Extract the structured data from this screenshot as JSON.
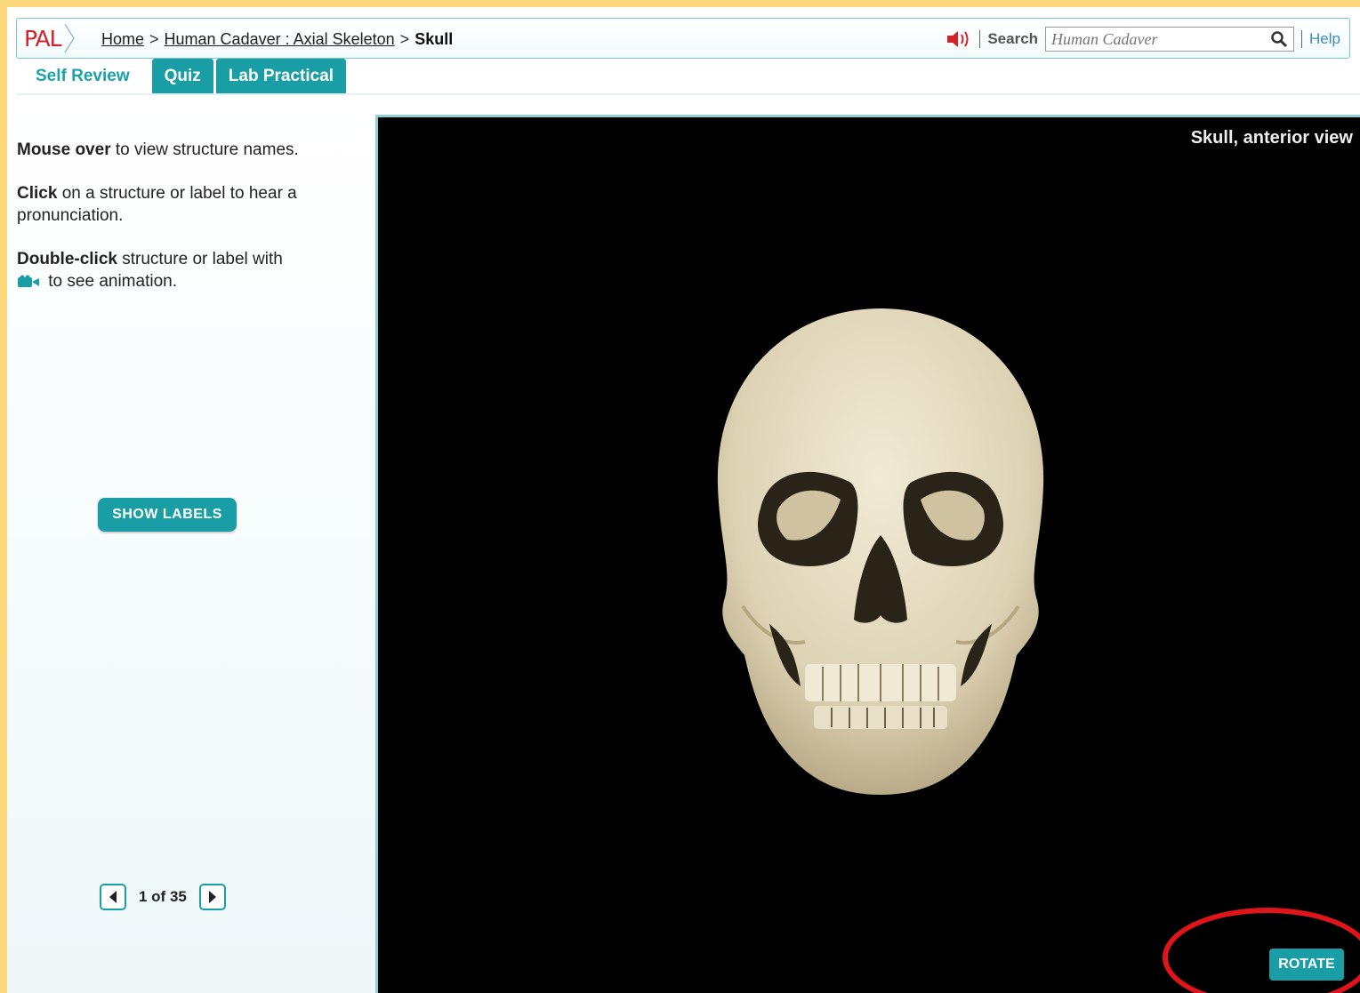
{
  "header": {
    "logo": "PAL",
    "breadcrumb": {
      "home": "Home",
      "section": "Human Cadaver : Axial Skeleton",
      "current": "Skull",
      "sep": ">"
    },
    "search_label": "Search",
    "search_placeholder": "Human Cadaver",
    "help": "Help"
  },
  "tabs": [
    {
      "label": "Self Review",
      "active": true
    },
    {
      "label": "Quiz",
      "active": false
    },
    {
      "label": "Lab Practical",
      "active": false
    }
  ],
  "instructions": {
    "mouse_bold": "Mouse over",
    "mouse_rest": " to view structure names.",
    "click_bold": "Click",
    "click_rest": " on a structure or label to hear a pronunciation.",
    "dbl_bold": "Double-click",
    "dbl_rest": " structure or label with",
    "dbl_rest2": " to see animation."
  },
  "show_labels": "SHOW LABELS",
  "pager": {
    "text": "1 of 35"
  },
  "viewer": {
    "title": "Skull, anterior view",
    "rotate": "ROTATE"
  },
  "colors": {
    "accent": "#1a9ea6",
    "background": "#fcd87a",
    "highlight": "#e0141b"
  }
}
